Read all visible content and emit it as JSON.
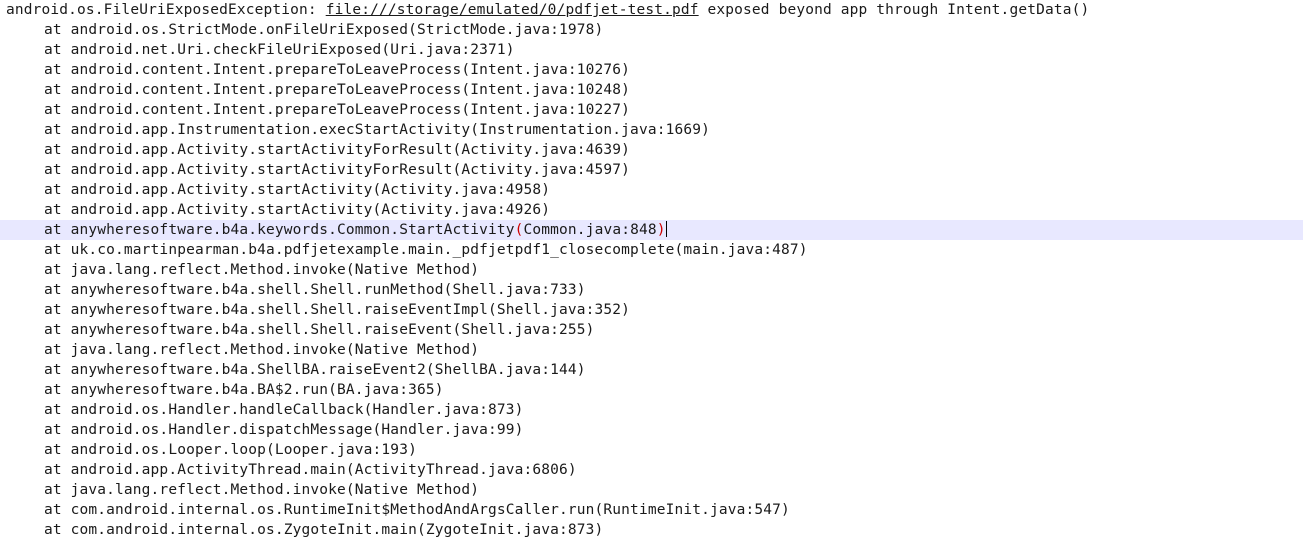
{
  "exception": {
    "type": "android.os.FileUriExposedException:",
    "uri": "file:///storage/emulated/0/pdfjet-test.pdf",
    "message": "exposed beyond app through Intent.getData()"
  },
  "frames": [
    "at android.os.StrictMode.onFileUriExposed(StrictMode.java:1978)",
    "at android.net.Uri.checkFileUriExposed(Uri.java:2371)",
    "at android.content.Intent.prepareToLeaveProcess(Intent.java:10276)",
    "at android.content.Intent.prepareToLeaveProcess(Intent.java:10248)",
    "at android.content.Intent.prepareToLeaveProcess(Intent.java:10227)",
    "at android.app.Instrumentation.execStartActivity(Instrumentation.java:1669)",
    "at android.app.Activity.startActivityForResult(Activity.java:4639)",
    "at android.app.Activity.startActivityForResult(Activity.java:4597)",
    "at android.app.Activity.startActivity(Activity.java:4958)",
    "at android.app.Activity.startActivity(Activity.java:4926)",
    "at anywheresoftware.b4a.keywords.Common.StartActivity(Common.java:848)",
    "at uk.co.martinpearman.b4a.pdfjetexample.main._pdfjetpdf1_closecomplete(main.java:487)",
    "at java.lang.reflect.Method.invoke(Native Method)",
    "at anywheresoftware.b4a.shell.Shell.runMethod(Shell.java:733)",
    "at anywheresoftware.b4a.shell.Shell.raiseEventImpl(Shell.java:352)",
    "at anywheresoftware.b4a.shell.Shell.raiseEvent(Shell.java:255)",
    "at java.lang.reflect.Method.invoke(Native Method)",
    "at anywheresoftware.b4a.ShellBA.raiseEvent2(ShellBA.java:144)",
    "at anywheresoftware.b4a.BA$2.run(BA.java:365)",
    "at android.os.Handler.handleCallback(Handler.java:873)",
    "at android.os.Handler.dispatchMessage(Handler.java:99)",
    "at android.os.Looper.loop(Looper.java:193)",
    "at android.app.ActivityThread.main(ActivityThread.java:6806)",
    "at java.lang.reflect.Method.invoke(Native Method)",
    "at com.android.internal.os.RuntimeInit$MethodAndArgsCaller.run(RuntimeInit.java:547)",
    "at com.android.internal.os.ZygoteInit.main(ZygoteInit.java:873)"
  ],
  "current_line": {
    "index": 10,
    "before_paren": "at anywheresoftware.b4a.keywords.Common.StartActivity",
    "open_paren": "(",
    "args": "Common.java:848",
    "close_paren": ")"
  },
  "colors": {
    "background": "#ffffff",
    "text": "#1a1a1a",
    "current_line_highlight": "#e8e8ff",
    "bracket_match": "#d00000"
  }
}
